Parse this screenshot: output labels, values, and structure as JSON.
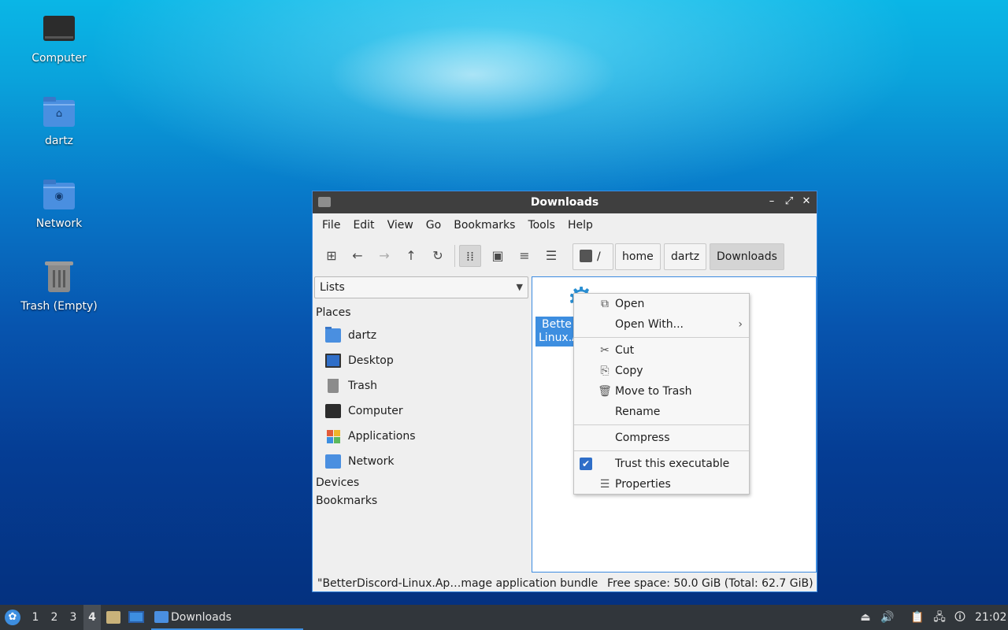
{
  "desktop": {
    "icons": [
      {
        "label": "Computer",
        "icon": "computer-icon"
      },
      {
        "label": "dartz",
        "icon": "home-folder-icon"
      },
      {
        "label": "Network",
        "icon": "network-folder-icon"
      },
      {
        "label": "Trash (Empty)",
        "icon": "trash-icon"
      }
    ]
  },
  "window": {
    "title": "Downloads",
    "menu": [
      "File",
      "Edit",
      "View",
      "Go",
      "Bookmarks",
      "Tools",
      "Help"
    ],
    "breadcrumb": [
      "/",
      "home",
      "dartz",
      "Downloads"
    ],
    "sidebar": {
      "mode": "Lists",
      "places_heading": "Places",
      "places": [
        "dartz",
        "Desktop",
        "Trash",
        "Computer",
        "Applications",
        "Network"
      ],
      "devices_heading": "Devices",
      "bookmarks_heading": "Bookmarks"
    },
    "file": {
      "label_line1": "Bette",
      "label_line2": "Linux.A"
    },
    "status": {
      "selection": "\"BetterDiscord-Linux.Ap…mage application bundle",
      "free_space": "Free space: 50.0 GiB (Total: 62.7 GiB)"
    }
  },
  "context_menu": {
    "items": [
      {
        "label": "Open",
        "icon": "open-icon"
      },
      {
        "label": "Open With...",
        "icon": "",
        "submenu": true
      },
      {
        "label": "Cut",
        "icon": "cut-icon"
      },
      {
        "label": "Copy",
        "icon": "copy-icon"
      },
      {
        "label": "Move to Trash",
        "icon": "trash-icon"
      },
      {
        "label": "Rename",
        "icon": ""
      },
      {
        "label": "Compress",
        "icon": ""
      },
      {
        "label": "Trust this executable",
        "icon": "checkbox-checked-icon",
        "checked": true
      },
      {
        "label": "Properties",
        "icon": "properties-icon"
      }
    ]
  },
  "taskbar": {
    "workspaces": [
      "1",
      "2",
      "3",
      "4"
    ],
    "active_workspace": "4",
    "task": "Downloads",
    "clock": "21:02"
  },
  "colors": {
    "accent": "#3d8ee0",
    "titlebar": "#3f3f3f",
    "taskbar": "#31363b"
  }
}
